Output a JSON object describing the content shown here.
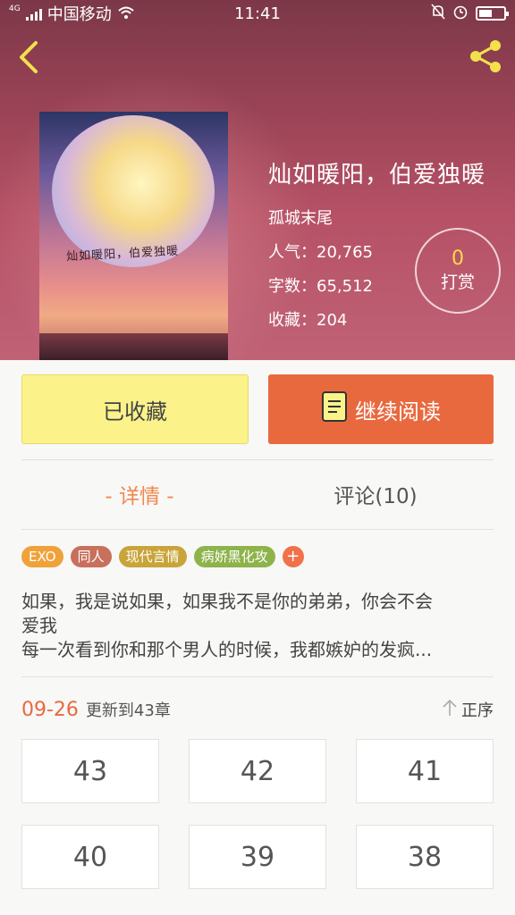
{
  "status_bar": {
    "network_type": "4G",
    "carrier": "中国移动",
    "time": "11:41",
    "battery_level": 0.55
  },
  "colors": {
    "accent_orange": "#e9693f",
    "tab_active": "#f0884e",
    "collect_button_bg": "#fbf38a",
    "tip_count": "#ffd84a",
    "back_icon": "#f4e04d",
    "share_icon": "#f4e04d"
  },
  "header": {
    "back_icon": "chevron-left-icon",
    "share_icon": "share-icon"
  },
  "book": {
    "cover_art_text": "灿如暖阳，伯爱独暖",
    "title": "灿如暖阳，伯爱独暖",
    "author": "孤城末尾",
    "popularity": "人气：20,765",
    "word_count": "字数：65,512",
    "favorites": "收藏：204"
  },
  "tip": {
    "count": "0",
    "label": "打赏"
  },
  "actions": {
    "collect_label": "已收藏",
    "read_label": "继续阅读",
    "read_icon": "book-icon"
  },
  "tabs": {
    "detail": "- 详情 -",
    "comments": "评论(10)"
  },
  "tags": [
    {
      "label": "EXO",
      "color": "#f0a23a"
    },
    {
      "label": "同人",
      "color": "#c8705c"
    },
    {
      "label": "现代言情",
      "color": "#c9a43a"
    },
    {
      "label": "病娇黑化攻",
      "color": "#8db34a"
    }
  ],
  "tag_add": "+",
  "synopsis": [
    "如果，我是说如果，如果我不是你的弟弟，你会不会",
    "爱我",
    "每一次看到你和那个男人的时候，我都嫉妒的发疯..."
  ],
  "update": {
    "date": "09-26",
    "text": "更新到43章",
    "sort_label": "正序",
    "sort_icon": "arrow-up-icon"
  },
  "chapters": [
    "43",
    "42",
    "41",
    "40",
    "39",
    "38"
  ]
}
